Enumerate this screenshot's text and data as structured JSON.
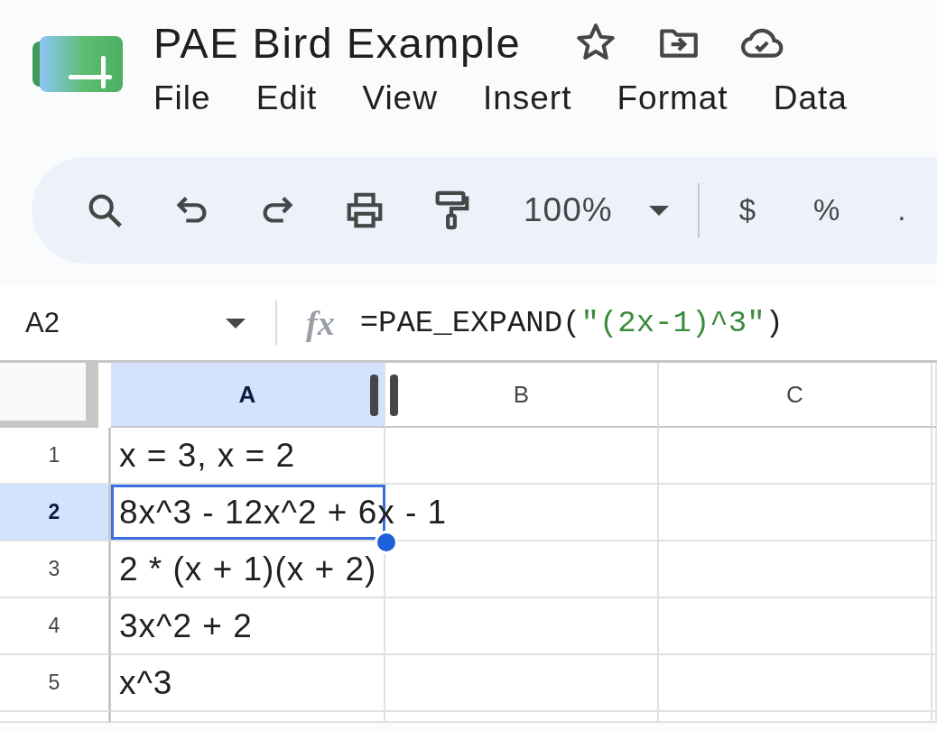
{
  "document": {
    "title": "PAE Bird Example"
  },
  "menu": [
    "File",
    "Edit",
    "View",
    "Insert",
    "Format",
    "Data"
  ],
  "toolbar": {
    "zoom": "100%",
    "format_buttons": [
      "$",
      "%",
      "."
    ]
  },
  "formula_bar": {
    "cell_ref": "A2",
    "function_label": "fx",
    "formula": [
      {
        "kind": "text",
        "text": "=PAE_EXPAND("
      },
      {
        "kind": "string",
        "text": "\"(2x-1)^3\""
      },
      {
        "kind": "text",
        "text": ")"
      }
    ]
  },
  "grid": {
    "columns": [
      {
        "label": "A",
        "selected": true
      },
      {
        "label": "B",
        "selected": false
      },
      {
        "label": "C",
        "selected": false
      }
    ],
    "rows": [
      {
        "label": "1",
        "selected": false,
        "cell_selected": false,
        "value": "x = 3, x = 2"
      },
      {
        "label": "2",
        "selected": true,
        "cell_selected": true,
        "value": "8x^3 - 12x^2 + 6x - 1"
      },
      {
        "label": "3",
        "selected": false,
        "cell_selected": false,
        "value": "2 * (x + 1)(x + 2)"
      },
      {
        "label": "4",
        "selected": false,
        "cell_selected": false,
        "value": "3x^2 + 2"
      },
      {
        "label": "5",
        "selected": false,
        "cell_selected": false,
        "value": "x^3"
      }
    ]
  }
}
